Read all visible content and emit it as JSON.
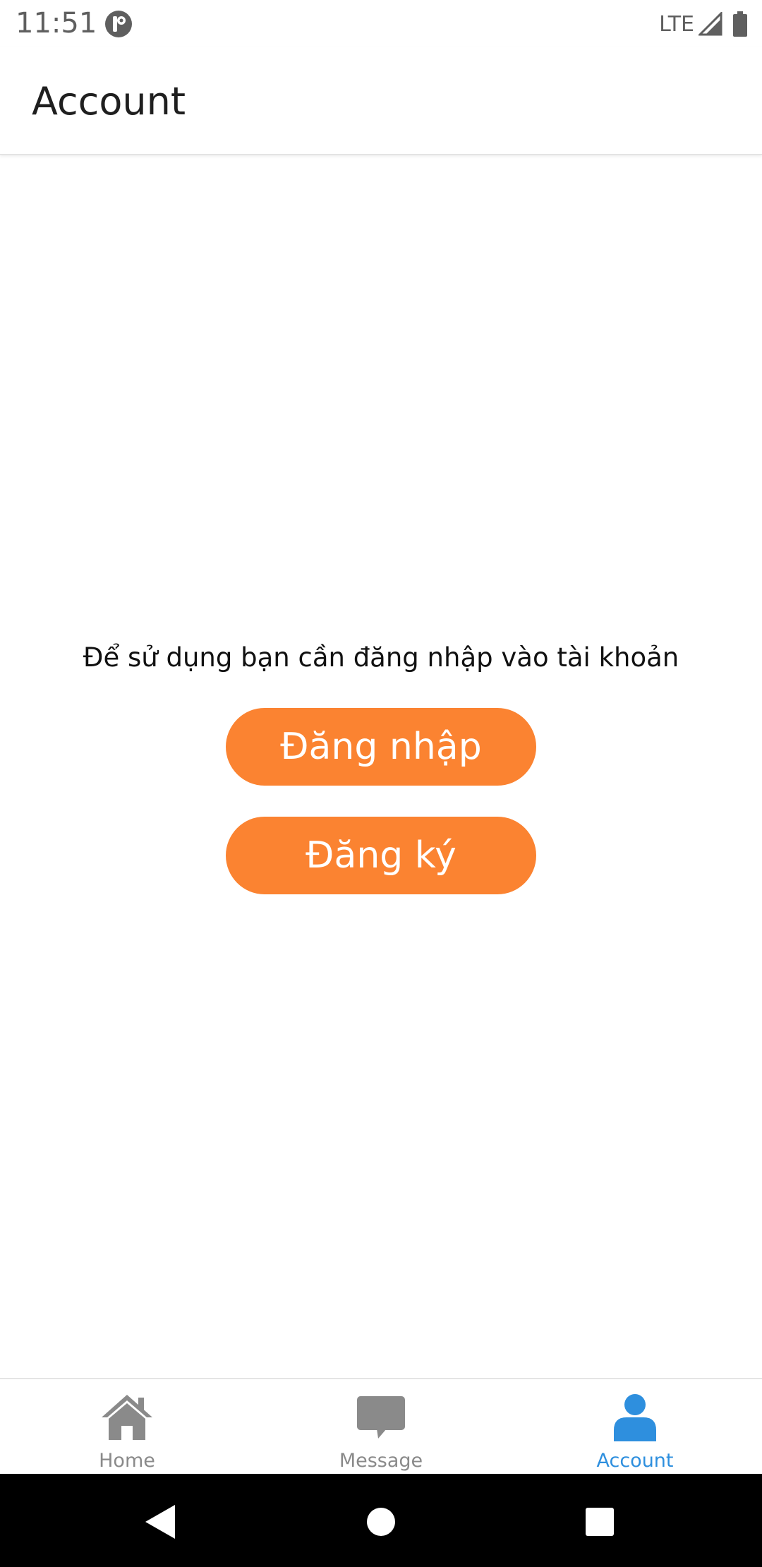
{
  "status_bar": {
    "time": "11:51",
    "network": "LTE",
    "colors": {
      "text": "#5f5f5f"
    }
  },
  "app_bar": {
    "title": "Account"
  },
  "content": {
    "prompt": "Để sử dụng bạn cần đăng nhập vào tài khoản",
    "login_label": "Đăng nhập",
    "register_label": "Đăng ký"
  },
  "bottom_nav": {
    "items": [
      {
        "label": "Home",
        "icon": "home-icon",
        "active": false
      },
      {
        "label": "Message",
        "icon": "message-icon",
        "active": false
      },
      {
        "label": "Account",
        "icon": "account-icon",
        "active": true
      }
    ]
  },
  "colors": {
    "accent_orange": "#fb8331",
    "active_blue": "#2e8fde",
    "inactive_gray": "#8a8a8a"
  }
}
